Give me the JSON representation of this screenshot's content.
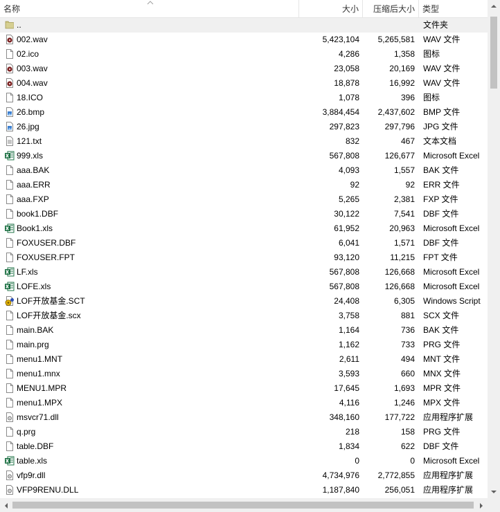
{
  "columns": {
    "name": "名称",
    "size": "大小",
    "compressed": "压缩后大小",
    "type": "类型"
  },
  "rows": [
    {
      "name": "..",
      "size": "",
      "compressed": "",
      "type": "文件夹",
      "icon": "folder-icon"
    },
    {
      "name": "002.wav",
      "size": "5,423,104",
      "compressed": "5,265,581",
      "type": "WAV 文件",
      "icon": "audio-file-icon"
    },
    {
      "name": "02.ico",
      "size": "4,286",
      "compressed": "1,358",
      "type": "图标",
      "icon": "blank-file-icon"
    },
    {
      "name": "003.wav",
      "size": "23,058",
      "compressed": "20,169",
      "type": "WAV 文件",
      "icon": "audio-file-icon"
    },
    {
      "name": "004.wav",
      "size": "18,878",
      "compressed": "16,992",
      "type": "WAV 文件",
      "icon": "audio-file-icon"
    },
    {
      "name": "18.ICO",
      "size": "1,078",
      "compressed": "396",
      "type": "图标",
      "icon": "blank-file-icon"
    },
    {
      "name": "26.bmp",
      "size": "3,884,454",
      "compressed": "2,437,602",
      "type": "BMP 文件",
      "icon": "image-file-icon"
    },
    {
      "name": "26.jpg",
      "size": "297,823",
      "compressed": "297,796",
      "type": "JPG 文件",
      "icon": "image-file-icon"
    },
    {
      "name": "121.txt",
      "size": "832",
      "compressed": "467",
      "type": "文本文档",
      "icon": "text-file-icon"
    },
    {
      "name": "999.xls",
      "size": "567,808",
      "compressed": "126,677",
      "type": "Microsoft Excel",
      "icon": "excel-file-icon"
    },
    {
      "name": "aaa.BAK",
      "size": "4,093",
      "compressed": "1,557",
      "type": "BAK 文件",
      "icon": "blank-file-icon"
    },
    {
      "name": "aaa.ERR",
      "size": "92",
      "compressed": "92",
      "type": "ERR 文件",
      "icon": "blank-file-icon"
    },
    {
      "name": "aaa.FXP",
      "size": "5,265",
      "compressed": "2,381",
      "type": "FXP 文件",
      "icon": "blank-file-icon"
    },
    {
      "name": "book1.DBF",
      "size": "30,122",
      "compressed": "7,541",
      "type": "DBF 文件",
      "icon": "blank-file-icon"
    },
    {
      "name": "Book1.xls",
      "size": "61,952",
      "compressed": "20,963",
      "type": "Microsoft Excel",
      "icon": "excel-file-icon"
    },
    {
      "name": "FOXUSER.DBF",
      "size": "6,041",
      "compressed": "1,571",
      "type": "DBF 文件",
      "icon": "blank-file-icon"
    },
    {
      "name": "FOXUSER.FPT",
      "size": "93,120",
      "compressed": "11,215",
      "type": "FPT 文件",
      "icon": "blank-file-icon"
    },
    {
      "name": "LF.xls",
      "size": "567,808",
      "compressed": "126,668",
      "type": "Microsoft Excel",
      "icon": "excel-file-icon"
    },
    {
      "name": "LOFE.xls",
      "size": "567,808",
      "compressed": "126,668",
      "type": "Microsoft Excel",
      "icon": "excel-file-icon"
    },
    {
      "name": "LOF开放基金.SCT",
      "size": "24,408",
      "compressed": "6,305",
      "type": "Windows Script",
      "icon": "script-file-icon"
    },
    {
      "name": "LOF开放基金.scx",
      "size": "3,758",
      "compressed": "881",
      "type": "SCX 文件",
      "icon": "blank-file-icon"
    },
    {
      "name": "main.BAK",
      "size": "1,164",
      "compressed": "736",
      "type": "BAK 文件",
      "icon": "blank-file-icon"
    },
    {
      "name": "main.prg",
      "size": "1,162",
      "compressed": "733",
      "type": "PRG 文件",
      "icon": "blank-file-icon"
    },
    {
      "name": "menu1.MNT",
      "size": "2,611",
      "compressed": "494",
      "type": "MNT 文件",
      "icon": "blank-file-icon"
    },
    {
      "name": "menu1.mnx",
      "size": "3,593",
      "compressed": "660",
      "type": "MNX 文件",
      "icon": "blank-file-icon"
    },
    {
      "name": "MENU1.MPR",
      "size": "17,645",
      "compressed": "1,693",
      "type": "MPR 文件",
      "icon": "blank-file-icon"
    },
    {
      "name": "menu1.MPX",
      "size": "4,116",
      "compressed": "1,246",
      "type": "MPX 文件",
      "icon": "blank-file-icon"
    },
    {
      "name": "msvcr71.dll",
      "size": "348,160",
      "compressed": "177,722",
      "type": "应用程序扩展",
      "icon": "dll-file-icon"
    },
    {
      "name": "q.prg",
      "size": "218",
      "compressed": "158",
      "type": "PRG 文件",
      "icon": "blank-file-icon"
    },
    {
      "name": "table.DBF",
      "size": "1,834",
      "compressed": "622",
      "type": "DBF 文件",
      "icon": "blank-file-icon"
    },
    {
      "name": "table.xls",
      "size": "0",
      "compressed": "0",
      "type": "Microsoft Excel",
      "icon": "excel-file-icon"
    },
    {
      "name": "vfp9r.dll",
      "size": "4,734,976",
      "compressed": "2,772,855",
      "type": "应用程序扩展",
      "icon": "dll-file-icon"
    },
    {
      "name": "VFP9RENU.DLL",
      "size": "1,187,840",
      "compressed": "256,051",
      "type": "应用程序扩展",
      "icon": "dll-file-icon"
    }
  ]
}
